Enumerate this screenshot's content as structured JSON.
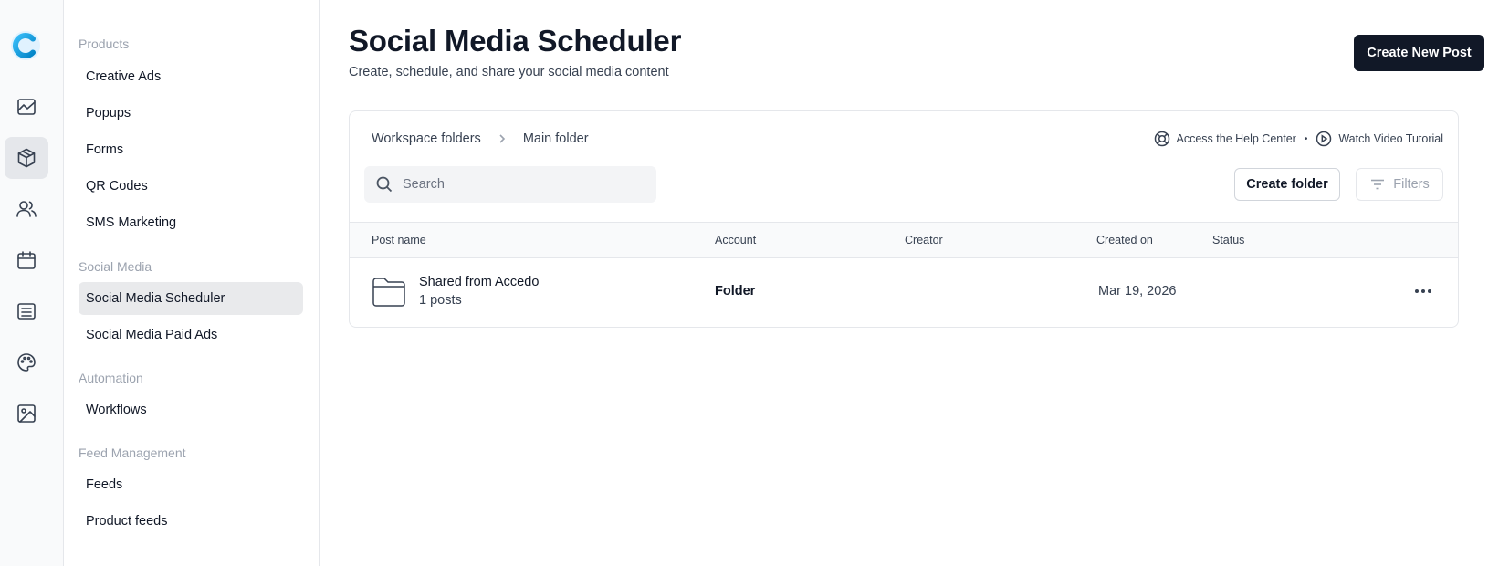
{
  "rail": {
    "items": [
      {
        "name": "analytics-icon"
      },
      {
        "name": "products-box-icon"
      },
      {
        "name": "contacts-users-icon"
      },
      {
        "name": "calendar-icon"
      },
      {
        "name": "list-icon"
      },
      {
        "name": "palette-icon"
      },
      {
        "name": "image-icon"
      }
    ],
    "active": "products-box-icon",
    "logo_color": "#0ea5e9"
  },
  "subnav": {
    "sections": [
      {
        "title": "Products",
        "items": [
          "Creative Ads",
          "Popups",
          "Forms",
          "QR Codes",
          "SMS Marketing"
        ]
      },
      {
        "title": "Social Media",
        "items": [
          "Social Media Scheduler",
          "Social Media Paid Ads"
        ]
      },
      {
        "title": "Automation",
        "items": [
          "Workflows"
        ]
      },
      {
        "title": "Feed Management",
        "items": [
          "Feeds",
          "Product feeds"
        ]
      }
    ],
    "active_item": "Social Media Scheduler"
  },
  "header": {
    "title": "Social Media Scheduler",
    "subtitle": "Create, schedule, and share your social media content",
    "primary_button": "Create New Post"
  },
  "card": {
    "breadcrumb": [
      "Workspace folders",
      "Main folder"
    ],
    "help_center": "Access the Help Center",
    "separator": "•",
    "video_tutorial": "Watch Video Tutorial",
    "search_placeholder": "Search",
    "create_folder": "Create folder",
    "filters": "Filters",
    "columns": [
      "Post name",
      "Account",
      "Creator",
      "Created on",
      "Status"
    ],
    "rows": [
      {
        "name": "Shared from Accedo",
        "sub": "1 posts",
        "account": "Folder",
        "creator": "",
        "created_on": "Mar 19, 2026",
        "status": ""
      }
    ]
  },
  "colors": {
    "primary": "#111827",
    "active_bg": "#e9eaec",
    "border": "#e5e7eb"
  }
}
